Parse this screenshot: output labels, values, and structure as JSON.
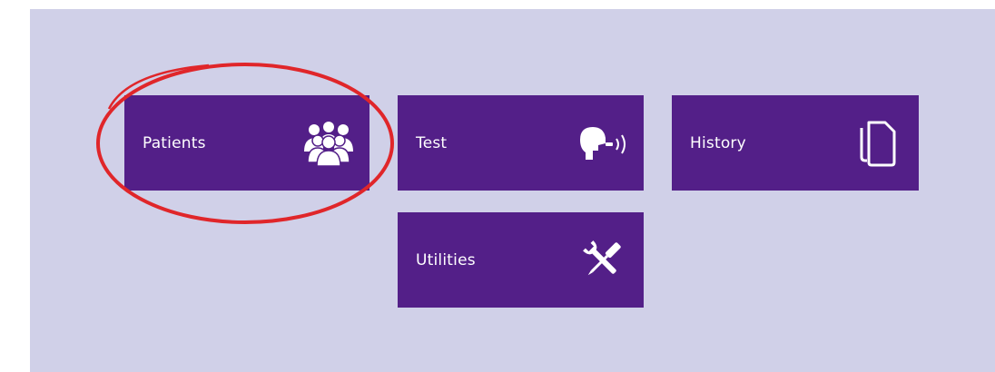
{
  "tiles": [
    {
      "label": "Patients",
      "icon": "users-group-icon"
    },
    {
      "label": "Test",
      "icon": "exhale-breath-icon"
    },
    {
      "label": "History",
      "icon": "documents-icon"
    },
    {
      "label": "Utilities",
      "icon": "wrench-screwdriver-icon"
    }
  ],
  "colors": {
    "background": "#d0d0e8",
    "tile": "#531f88",
    "tile_text": "#ffffff",
    "highlight_ring": "#e0262a"
  },
  "highlight": {
    "target": "Patients"
  }
}
